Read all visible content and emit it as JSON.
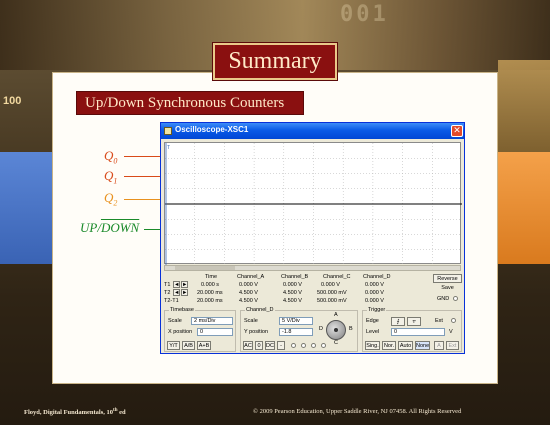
{
  "slide": {
    "title": "Summary",
    "subtitle": "Up/Down Synchronous Counters",
    "deco_number": "100",
    "deco_digits": "001",
    "footer_left": "Floyd, Digital Fundamentals, 10",
    "footer_left_sup": "th",
    "footer_left_end": " ed",
    "footer_right": "© 2009 Pearson Education, Upper Saddle River, NJ 07458. All Rights Reserved"
  },
  "signals": [
    {
      "name": "Q",
      "sub": "0",
      "color": "#d94a1a"
    },
    {
      "name": "Q",
      "sub": "1",
      "color": "#d94a1a"
    },
    {
      "name": "Q",
      "sub": "2",
      "color": "#e8911e"
    },
    {
      "name": "UP/",
      "overline": "DOWN",
      "color": "#1a8a2a"
    }
  ],
  "window": {
    "title": "Oscilloscope-XSC1",
    "close_glyph": "✕",
    "marker": "T"
  },
  "readout": {
    "t1_label": "T1",
    "t2_label": "T2",
    "t2t1_label": "T2-T1",
    "arrow_left": "◄",
    "arrow_right": "►",
    "headers": [
      "Time",
      "Channel_A",
      "Channel_B",
      "Channel_C",
      "Channel_D"
    ],
    "rows": [
      [
        "0.000 s",
        "0.000 V",
        "0.000 V",
        "0.000 V",
        "0.000 V"
      ],
      [
        "20.000 ms",
        "4.500 V",
        "4.500 V",
        "500.000 mV",
        "0.000 V"
      ],
      [
        "20.000 ms",
        "4.500 V",
        "4.500 V",
        "500.000 mV",
        "0.000 V"
      ]
    ],
    "reverse": "Reverse",
    "save": "Save",
    "gnd": "GND"
  },
  "timebase": {
    "title": "Timebase",
    "scale_label": "Scale",
    "scale_value": "2 ms/Div",
    "xpos_label": "X position",
    "xpos_value": "0",
    "modes": [
      "Y/T",
      "A/B",
      "A+B"
    ]
  },
  "channel": {
    "title": "Channel_D",
    "scale_label": "Scale",
    "scale_value": "5 V/Div",
    "ypos_label": "Y position",
    "ypos_value": "-1.8",
    "coupling": [
      "AC",
      "0",
      "DC",
      "-"
    ],
    "knob_labels": [
      "A",
      "B",
      "C",
      "D"
    ]
  },
  "trigger": {
    "title": "Trigger",
    "edge_label": "Edge",
    "edge_rise": "⨍",
    "edge_fall": "⥾",
    "ext_label": "Ext",
    "level_label": "Level",
    "level_value": "0",
    "level_unit": "V",
    "modes": [
      "Sing.",
      "Nor.",
      "Auto",
      "None"
    ],
    "extra": [
      "A",
      "Ext"
    ]
  }
}
